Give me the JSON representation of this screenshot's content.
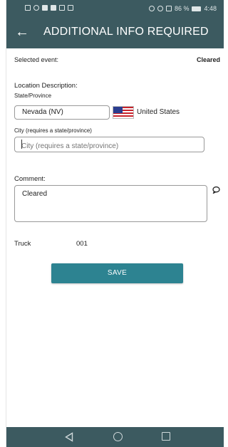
{
  "status_bar": {
    "battery_percent": "86 %",
    "time": "4:48"
  },
  "header": {
    "back_icon": "arrow-left-icon",
    "title": "ADDITIONAL INFO REQUIRED"
  },
  "selected_event": {
    "label": "Selected event:",
    "value": "Cleared"
  },
  "location": {
    "label": "Location Description:",
    "state_label": "State/Province",
    "state_value": "Nevada (NV)",
    "country_flag": "us-flag-icon",
    "country": "United States",
    "city_label": "City (requires a state/province)",
    "city_value": "",
    "city_placeholder": "City (requires a state/province)"
  },
  "comment": {
    "label": "Comment:",
    "value": "Cleared",
    "icon": "speech-bubble-icon"
  },
  "truck": {
    "label": "Truck",
    "value": "001"
  },
  "actions": {
    "save_label": "SAVE"
  },
  "nav_bar": {
    "back_icon": "nav-back-icon",
    "home_icon": "nav-home-icon",
    "recents_icon": "nav-recents-icon"
  },
  "colors": {
    "app_bar": "#3c5a60",
    "save_button": "#2d8391"
  }
}
